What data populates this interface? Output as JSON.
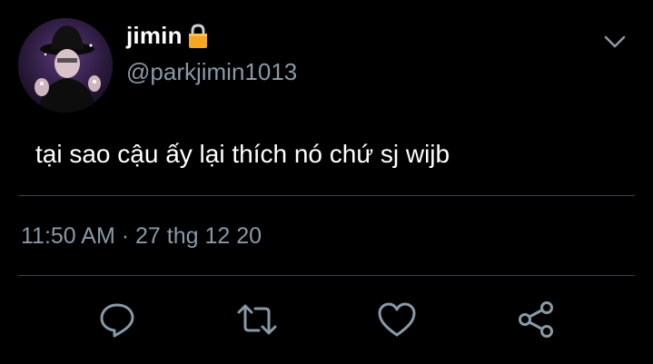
{
  "tweet": {
    "display_name": "jimin",
    "handle": "@parkjimin1013",
    "text": "tại sao cậu ấy lại thích nó chứ sj wijb",
    "time": "11:50 AM",
    "separator": "·",
    "date": "27 thg 12 20"
  },
  "icons": {
    "lock": "lock-icon",
    "menu": "chevron-down-icon",
    "reply": "reply-icon",
    "retweet": "retweet-icon",
    "like": "heart-icon",
    "share": "share-icon"
  },
  "colors": {
    "background": "#000000",
    "primary_text": "#ffffff",
    "secondary_text": "#8899a6",
    "divider": "#38444d",
    "icon": "#8899a6",
    "lock": "#f5a623"
  }
}
